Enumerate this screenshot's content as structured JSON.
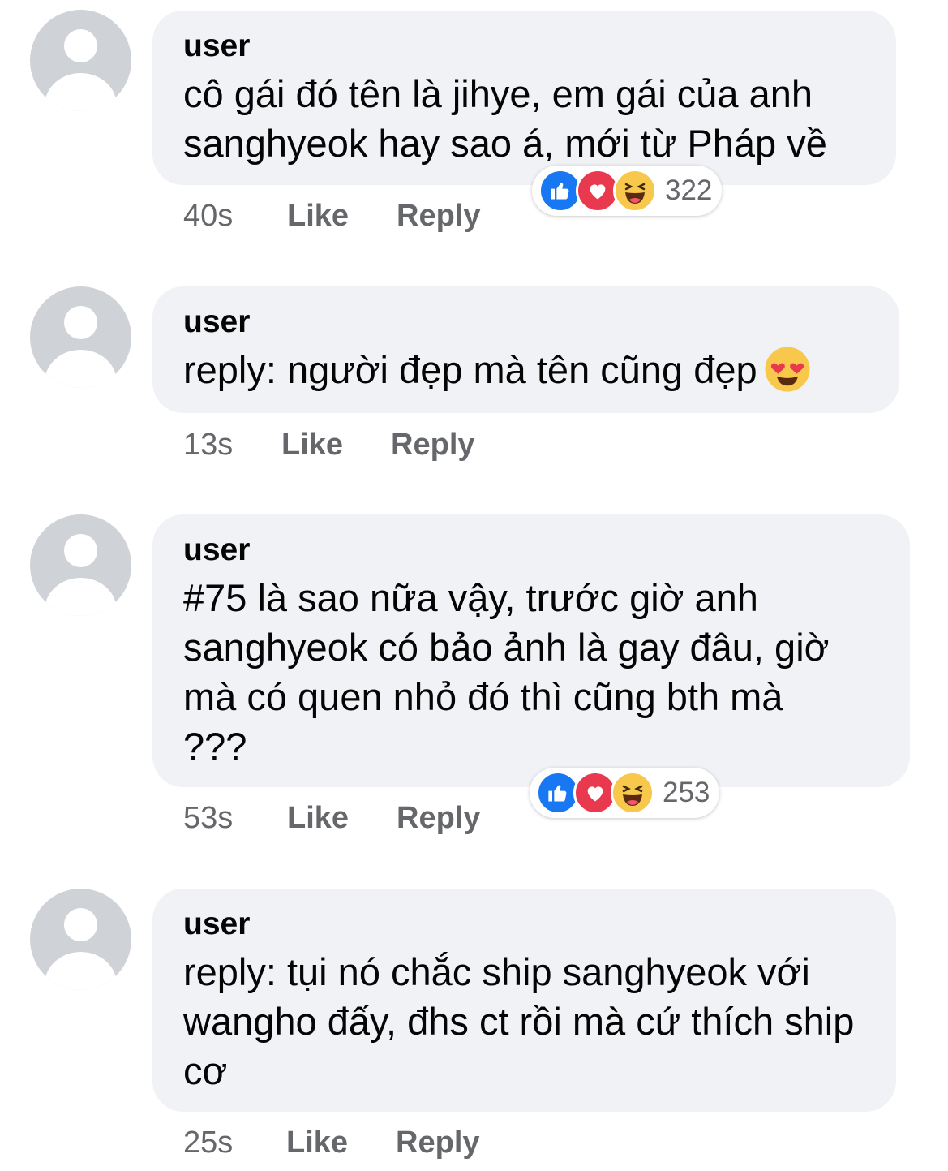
{
  "comments": [
    {
      "author": "user",
      "text": "cô gái đó tên là jihye, em gái của anh sanghyeok hay sao á, mới từ Pháp về",
      "time": "40s",
      "like_label": "Like",
      "reply_label": "Reply",
      "reaction_count": "322",
      "reactions": [
        "like-icon",
        "love-icon",
        "haha-icon"
      ]
    },
    {
      "author": "user",
      "text": "reply: người đẹp mà tên cũng đẹp",
      "text_emoji": "heart-eyes-emoji",
      "time": "13s",
      "like_label": "Like",
      "reply_label": "Reply"
    },
    {
      "author": "user",
      "text": "#75 là sao nữa vậy, trước giờ anh sanghyeok có bảo ảnh là gay đâu, giờ mà có quen nhỏ đó thì cũng bth mà ???",
      "time": "53s",
      "like_label": "Like",
      "reply_label": "Reply",
      "reaction_count": "253",
      "reactions": [
        "like-icon",
        "love-icon",
        "haha-icon"
      ]
    },
    {
      "author": "user",
      "text": "reply: tụi nó chắc ship sanghyeok với wangho đấy, đhs ct rồi mà cứ thích ship cơ",
      "time": "25s",
      "like_label": "Like",
      "reply_label": "Reply"
    }
  ],
  "colors": {
    "bubble": "#f0f2f5",
    "meta_text": "#65676b",
    "like": "#1877f2",
    "love": "#e9394f",
    "haha": "#f7c84b"
  }
}
